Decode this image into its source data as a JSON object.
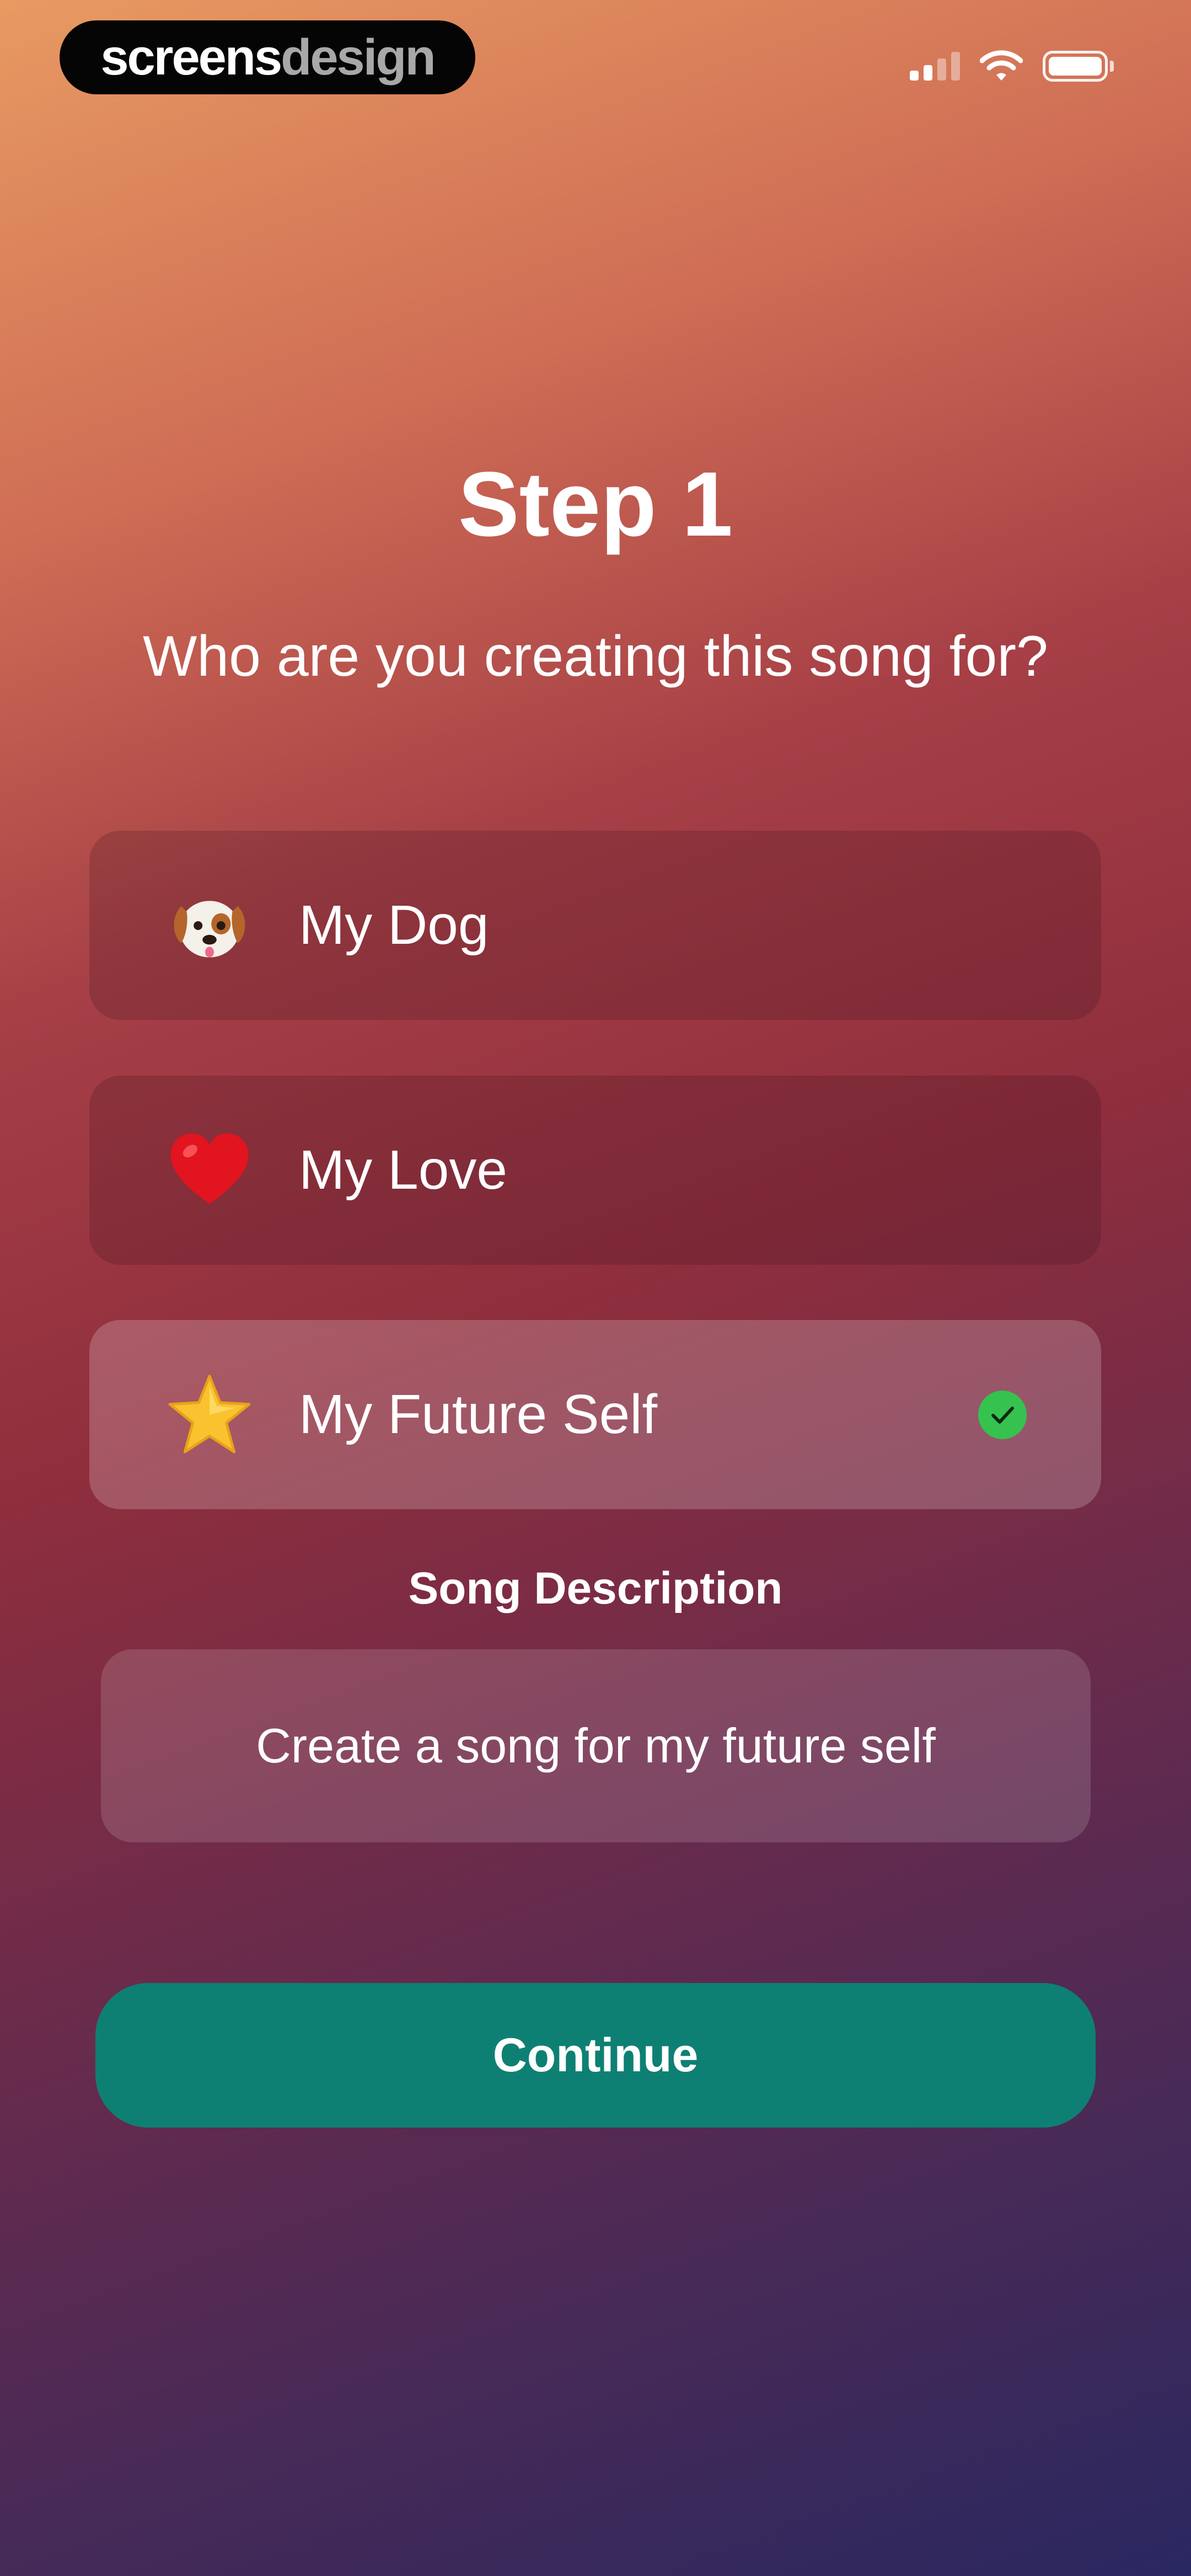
{
  "watermark": {
    "part1": "screens",
    "part2": "design"
  },
  "status_bar": {
    "icons": [
      "signal-icon",
      "wifi-icon",
      "battery-icon"
    ]
  },
  "header": {
    "title": "Step 1",
    "subtitle": "Who are you creating this song for?"
  },
  "options": [
    {
      "icon": "dog-face-emoji",
      "label": "My Dog",
      "selected": false
    },
    {
      "icon": "red-heart-emoji",
      "label": "My Love",
      "selected": false
    },
    {
      "icon": "star-emoji",
      "label": "My Future Self",
      "selected": true
    }
  ],
  "description": {
    "label": "Song Description",
    "value": "Create a song for my future self"
  },
  "continue_label": "Continue",
  "colors": {
    "accent_button": "#0e8073",
    "check": "#36c24f",
    "gradient_top": "#e89a62",
    "gradient_bottom": "#2a2860"
  }
}
